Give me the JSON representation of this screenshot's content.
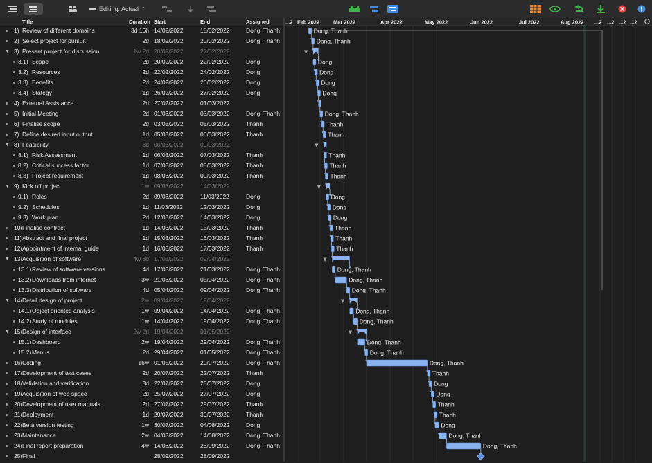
{
  "toolbar": {
    "editing_label": "Editing: Actual",
    "icons": [
      "outline-icon",
      "split-view-icon",
      "resource-icon",
      "editing-mode-icon",
      "link-tasks-icon",
      "baseline-icon",
      "reschedule-icon",
      "critical-path-icon",
      "resource-leveling-icon",
      "calendar-icon",
      "network-icon",
      "catch-up-icon",
      "level-icon",
      "stop-icon",
      "info-icon"
    ],
    "accent_colors": {
      "green": "#3fb24a",
      "blue": "#3d8be0",
      "orange": "#e08a3a",
      "red": "#e0463e"
    }
  },
  "columns": {
    "title": "Title",
    "duration": "Duration",
    "start": "Start",
    "end": "End",
    "assigned": "Assigned"
  },
  "timeline": {
    "months": [
      "...2",
      "Feb 2022",
      "Mar 2022",
      "Apr 2022",
      "May 2022",
      "Jun 2022",
      "Jul 2022",
      "Aug 2022",
      "...2",
      "...2",
      "...2",
      "...2"
    ],
    "bar_color": "#8ab4f0",
    "background": "#1e1e1e"
  },
  "tasks": [
    {
      "num": "1)",
      "title": "Review of different domains",
      "duration": "3d 16h",
      "start": "14/02/2022",
      "end": "18/02/2022",
      "assigned": "Dong, Thanh",
      "level": 0,
      "summary": false,
      "label": "Dong, Thanh"
    },
    {
      "num": "2)",
      "title": "Select project for pursuit",
      "duration": "2d",
      "start": "18/02/2022",
      "end": "20/02/2022",
      "assigned": "Dong, Thanh",
      "level": 0,
      "summary": false,
      "label": "Dong, Thanh"
    },
    {
      "num": "3)",
      "title": "Present project for discussion",
      "duration": "1w 2d",
      "start": "20/02/2022",
      "end": "27/02/2022",
      "assigned": "",
      "level": 0,
      "summary": true,
      "label": ""
    },
    {
      "num": "3.1)",
      "title": "Scope",
      "duration": "2d",
      "start": "20/02/2022",
      "end": "22/02/2022",
      "assigned": "Dong",
      "level": 1,
      "summary": false,
      "label": "Dong"
    },
    {
      "num": "3.2)",
      "title": "Resources",
      "duration": "2d",
      "start": "22/02/2022",
      "end": "24/02/2022",
      "assigned": "Dong",
      "level": 1,
      "summary": false,
      "label": "Dong"
    },
    {
      "num": "3.3)",
      "title": "Benefits",
      "duration": "2d",
      "start": "24/02/2022",
      "end": "26/02/2022",
      "assigned": "Dong",
      "level": 1,
      "summary": false,
      "label": "Dong"
    },
    {
      "num": "3.4)",
      "title": "Stategy",
      "duration": "1d",
      "start": "26/02/2022",
      "end": "27/02/2022",
      "assigned": "Dong",
      "level": 1,
      "summary": false,
      "label": "Dong"
    },
    {
      "num": "4)",
      "title": "External Assistance",
      "duration": "2d",
      "start": "27/02/2022",
      "end": "01/03/2022",
      "assigned": "",
      "level": 0,
      "summary": false,
      "label": ""
    },
    {
      "num": "5)",
      "title": "Initial Meeting",
      "duration": "2d",
      "start": "01/03/2022",
      "end": "03/03/2022",
      "assigned": "Dong, Thanh",
      "level": 0,
      "summary": false,
      "label": "Dong, Thanh"
    },
    {
      "num": "6)",
      "title": "Finalise scope",
      "duration": "2d",
      "start": "03/03/2022",
      "end": "05/03/2022",
      "assigned": "Thanh",
      "level": 0,
      "summary": false,
      "label": "Thanh"
    },
    {
      "num": "7)",
      "title": "Define desired input output",
      "duration": "1d",
      "start": "05/03/2022",
      "end": "06/03/2022",
      "assigned": "Thanh",
      "level": 0,
      "summary": false,
      "label": "Thanh"
    },
    {
      "num": "8)",
      "title": "Feasibility",
      "duration": "3d",
      "start": "06/03/2022",
      "end": "09/03/2022",
      "assigned": "",
      "level": 0,
      "summary": true,
      "label": ""
    },
    {
      "num": "8.1)",
      "title": "Risk Assessment",
      "duration": "1d",
      "start": "06/03/2022",
      "end": "07/03/2022",
      "assigned": "Thanh",
      "level": 1,
      "summary": false,
      "label": "Thanh"
    },
    {
      "num": "8.2)",
      "title": "Critical success factor",
      "duration": "1d",
      "start": "07/03/2022",
      "end": "08/03/2022",
      "assigned": "Thanh",
      "level": 1,
      "summary": false,
      "label": "Thanh"
    },
    {
      "num": "8.3)",
      "title": "Project requirement",
      "duration": "1d",
      "start": "08/03/2022",
      "end": "09/03/2022",
      "assigned": "Thanh",
      "level": 1,
      "summary": false,
      "label": "Thanh"
    },
    {
      "num": "9)",
      "title": "Kick off project",
      "duration": "1w",
      "start": "09/03/2022",
      "end": "14/03/2022",
      "assigned": "",
      "level": 0,
      "summary": true,
      "label": ""
    },
    {
      "num": "9.1)",
      "title": "Roles",
      "duration": "2d",
      "start": "09/03/2022",
      "end": "11/03/2022",
      "assigned": "Dong",
      "level": 1,
      "summary": false,
      "label": "Dong"
    },
    {
      "num": "9.2)",
      "title": "Schedules",
      "duration": "1d",
      "start": "11/03/2022",
      "end": "12/03/2022",
      "assigned": "Dong",
      "level": 1,
      "summary": false,
      "label": "Dong"
    },
    {
      "num": "9.3)",
      "title": "Work plan",
      "duration": "2d",
      "start": "12/03/2022",
      "end": "14/03/2022",
      "assigned": "Dong",
      "level": 1,
      "summary": false,
      "label": "Dong"
    },
    {
      "num": "10)",
      "title": "Finalise contract",
      "duration": "1d",
      "start": "14/03/2022",
      "end": "15/03/2022",
      "assigned": "Thanh",
      "level": 0,
      "summary": false,
      "label": "Thanh"
    },
    {
      "num": "11)",
      "title": "Abstract and final project",
      "duration": "1d",
      "start": "15/03/2022",
      "end": "16/03/2022",
      "assigned": "Thanh",
      "level": 0,
      "summary": false,
      "label": "Thanh"
    },
    {
      "num": "12)",
      "title": "Appointment of internal guide",
      "duration": "1d",
      "start": "16/03/2022",
      "end": "17/03/2022",
      "assigned": "Thanh",
      "level": 0,
      "summary": false,
      "label": "Thanh"
    },
    {
      "num": "13)",
      "title": "Acquisition of software",
      "duration": "4w 3d",
      "start": "17/03/2022",
      "end": "09/04/2022",
      "assigned": "",
      "level": 0,
      "summary": true,
      "label": ""
    },
    {
      "num": "13.1)",
      "title": "Review of software versions",
      "duration": "4d",
      "start": "17/03/2022",
      "end": "21/03/2022",
      "assigned": "Dong, Thanh",
      "level": 1,
      "summary": false,
      "label": "Dong, Thanh"
    },
    {
      "num": "13.2)",
      "title": "Downloads from internet",
      "duration": "3w",
      "start": "21/03/2022",
      "end": "05/04/2022",
      "assigned": "Dong, Thanh",
      "level": 1,
      "summary": false,
      "label": "Dong, Thanh"
    },
    {
      "num": "13.3)",
      "title": "Distribution of software",
      "duration": "4d",
      "start": "05/04/2022",
      "end": "09/04/2022",
      "assigned": "Dong, Thanh",
      "level": 1,
      "summary": false,
      "label": "Dong, Thanh"
    },
    {
      "num": "14)",
      "title": "Detail design of project",
      "duration": "2w",
      "start": "09/04/2022",
      "end": "19/04/2022",
      "assigned": "",
      "level": 0,
      "summary": true,
      "label": ""
    },
    {
      "num": "14.1)",
      "title": "Object oriented analysis",
      "duration": "1w",
      "start": "09/04/2022",
      "end": "14/04/2022",
      "assigned": "Dong, Thanh",
      "level": 1,
      "summary": false,
      "label": "Dong, Thanh"
    },
    {
      "num": "14.2)",
      "title": "Study of modules",
      "duration": "1w",
      "start": "14/04/2022",
      "end": "19/04/2022",
      "assigned": "Dong, Thanh",
      "level": 1,
      "summary": false,
      "label": "Dong, Thanh"
    },
    {
      "num": "15)",
      "title": "Design of interface",
      "duration": "2w 2d",
      "start": "19/04/2022",
      "end": "01/05/2022",
      "assigned": "",
      "level": 0,
      "summary": true,
      "label": ""
    },
    {
      "num": "15.1)",
      "title": "Dashboard",
      "duration": "2w",
      "start": "19/04/2022",
      "end": "29/04/2022",
      "assigned": "Dong, Thanh",
      "level": 1,
      "summary": false,
      "label": "Dong, Thanh"
    },
    {
      "num": "15.2)",
      "title": "Menus",
      "duration": "2d",
      "start": "29/04/2022",
      "end": "01/05/2022",
      "assigned": "Dong, Thanh",
      "level": 1,
      "summary": false,
      "label": "Dong, Thanh"
    },
    {
      "num": "16)",
      "title": "Coding",
      "duration": "16w",
      "start": "01/05/2022",
      "end": "20/07/2022",
      "assigned": "Dong, Thanh",
      "level": 0,
      "summary": false,
      "label": "Dong, Thanh"
    },
    {
      "num": "17)",
      "title": "Development of test cases",
      "duration": "2d",
      "start": "20/07/2022",
      "end": "22/07/2022",
      "assigned": "Thanh",
      "level": 0,
      "summary": false,
      "label": "Thanh"
    },
    {
      "num": "18)",
      "title": "Validation and verification",
      "duration": "3d",
      "start": "22/07/2022",
      "end": "25/07/2022",
      "assigned": "Dong",
      "level": 0,
      "summary": false,
      "label": "Dong"
    },
    {
      "num": "19)",
      "title": "Acquisition of web space",
      "duration": "2d",
      "start": "25/07/2022",
      "end": "27/07/2022",
      "assigned": "Dong",
      "level": 0,
      "summary": false,
      "label": "Dong"
    },
    {
      "num": "20)",
      "title": "Development of user manuals",
      "duration": "2d",
      "start": "27/07/2022",
      "end": "29/07/2022",
      "assigned": "Thanh",
      "level": 0,
      "summary": false,
      "label": "Thanh"
    },
    {
      "num": "21)",
      "title": "Deployment",
      "duration": "1d",
      "start": "29/07/2022",
      "end": "30/07/2022",
      "assigned": "Thanh",
      "level": 0,
      "summary": false,
      "label": "Thanh"
    },
    {
      "num": "22)",
      "title": "Beta version testing",
      "duration": "1w",
      "start": "30/07/2022",
      "end": "04/08/2022",
      "assigned": "Dong",
      "level": 0,
      "summary": false,
      "label": "Dong"
    },
    {
      "num": "23)",
      "title": "Maintenance",
      "duration": "2w",
      "start": "04/08/2022",
      "end": "14/08/2022",
      "assigned": "Dong, Thanh",
      "level": 0,
      "summary": false,
      "label": "Dong, Thanh"
    },
    {
      "num": "24)",
      "title": "Final report preparation",
      "duration": "4w",
      "start": "14/08/2022",
      "end": "28/09/2022",
      "assigned": "Dong, Thanh",
      "level": 0,
      "summary": false,
      "label": "Dong, Thanh"
    },
    {
      "num": "25)",
      "title": "Final",
      "duration": "",
      "start": "28/09/2022",
      "end": "28/09/2022",
      "assigned": "",
      "level": 0,
      "summary": false,
      "milestone": true,
      "label": ""
    }
  ]
}
